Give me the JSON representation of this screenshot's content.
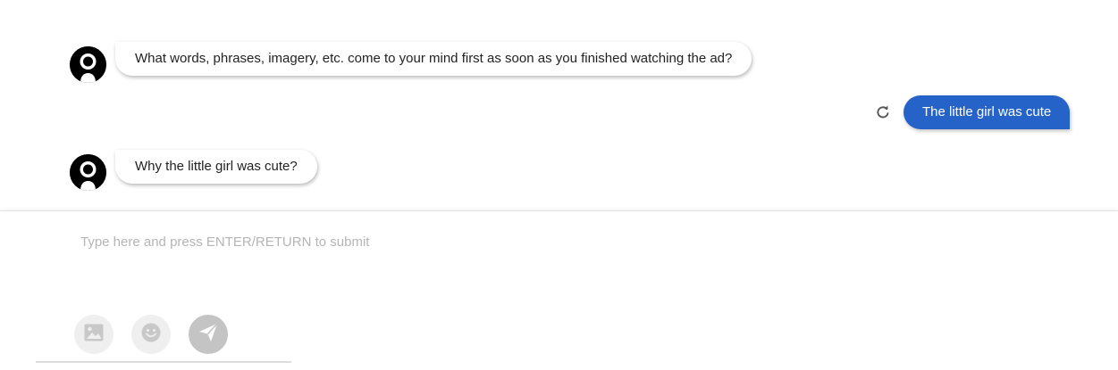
{
  "messages": [
    {
      "sender": "bot",
      "text": "What words, phrases, imagery, etc. come to your mind first as soon as you finished watching the ad?"
    },
    {
      "sender": "user",
      "text": "The little girl was cute"
    },
    {
      "sender": "bot",
      "text": "Why the little girl was cute?"
    }
  ],
  "composer": {
    "placeholder": "Type here and press ENTER/RETURN to submit",
    "value": ""
  },
  "icons": {
    "bot_avatar": "user-avatar-icon",
    "retry": "refresh-icon",
    "image": "image-icon",
    "emoji": "emoji-icon",
    "send": "send-icon"
  },
  "colors": {
    "user_bubble": "#2563c9",
    "bot_bubble": "#ffffff",
    "send_button": "#c4c4c4",
    "tool_button": "#efefef"
  }
}
